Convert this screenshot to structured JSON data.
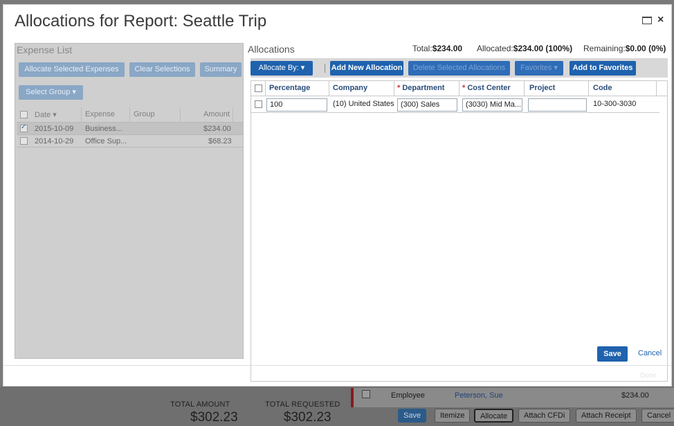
{
  "modal": {
    "title": "Allocations for Report: Seattle Trip",
    "done_label": "Done"
  },
  "expense_list": {
    "heading": "Expense List",
    "buttons": {
      "allocate_selected": "Allocate Selected Expenses",
      "clear_selections": "Clear Selections",
      "summary": "Summary",
      "select_group": "Select Group ▾"
    },
    "columns": [
      "Date ▾",
      "Expense",
      "Group",
      "Amount"
    ],
    "rows": [
      {
        "date": "2015-10-09",
        "expense": "Business...",
        "group": "",
        "amount": "$234.00",
        "checked": true
      },
      {
        "date": "2014-10-29",
        "expense": "Office Sup...",
        "group": "",
        "amount": "$68.23",
        "checked": false
      }
    ]
  },
  "allocations": {
    "heading": "Allocations",
    "total_label": "Total:",
    "total_value": "$234.00",
    "allocated_label": "Allocated:",
    "allocated_value": "$234.00 (100%)",
    "remaining_label": "Remaining:",
    "remaining_value": "$0.00 (0%)",
    "toolbar": {
      "allocate_by": "Allocate By: ▾",
      "add_new": "Add New Allocation",
      "delete_selected": "Delete Selected Allocations",
      "favorites": "Favorites ▾",
      "add_to_favorites": "Add to Favorites"
    },
    "columns": {
      "percentage": "Percentage",
      "company": "Company",
      "department": "Department",
      "cost_center": "Cost Center",
      "project": "Project",
      "code": "Code",
      "required_mark": "*"
    },
    "rows": [
      {
        "percentage": "100",
        "company": "(10) United States",
        "department": "(300) Sales",
        "cost_center": "(3030) Mid Ma...",
        "project": "",
        "code": "10-300-3030"
      }
    ],
    "save_label": "Save",
    "cancel_label": "Cancel"
  },
  "background": {
    "total_amount_label": "TOTAL AMOUNT",
    "total_amount_value": "$302.23",
    "total_requested_label": "TOTAL REQUESTED",
    "total_requested_value": "$302.23",
    "row": {
      "type": "Employee",
      "name": "Peterson, Sue",
      "amount": "$234.00"
    },
    "buttons": {
      "save": "Save",
      "itemize": "Itemize",
      "allocate": "Allocate",
      "attach_cfdi": "Attach CFDi",
      "attach_receipt": "Attach Receipt",
      "cancel": "Cancel"
    }
  }
}
